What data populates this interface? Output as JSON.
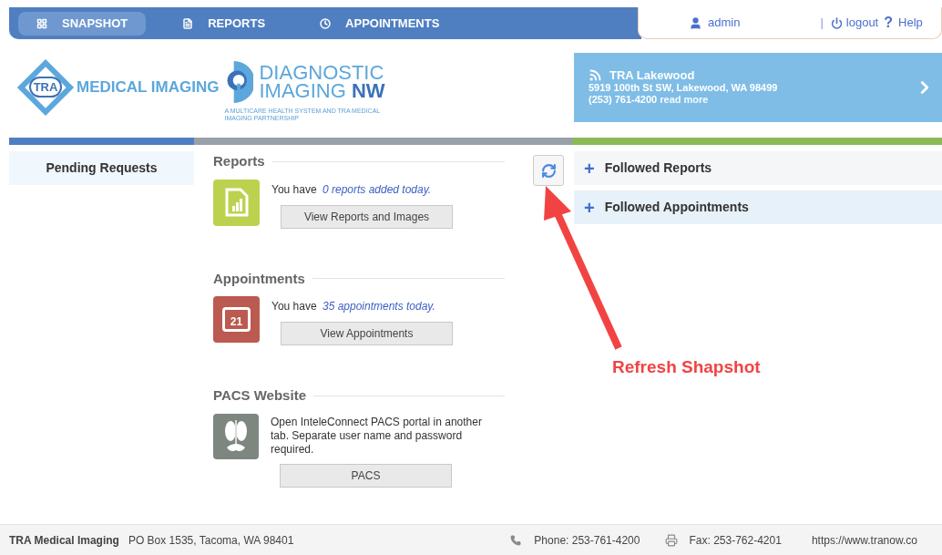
{
  "nav": {
    "tabs": [
      {
        "label": "SNAPSHOT",
        "selected": true
      },
      {
        "label": "REPORTS",
        "selected": false
      },
      {
        "label": "APPOINTMENTS",
        "selected": false
      }
    ],
    "user": "admin",
    "separator": "|",
    "logout": "logout",
    "help_icon": "?",
    "help": "Help"
  },
  "logos": {
    "tra_badge": "TRA",
    "tra_name": "MEDICAL IMAGING",
    "dinw_line1": "DIAGNOSTIC",
    "dinw_line2a": "IMAGING",
    "dinw_line2b": "NW",
    "dinw_tagline": "A MULTICARE HEALTH SYSTEM AND TRA MEDICAL IMAGING PARTNERSHIP"
  },
  "location": {
    "name": "TRA Lakewood",
    "address": "5919 100th St SW, Lakewood, WA 98499",
    "phone": "(253) 761-4200",
    "link": "read more"
  },
  "sidebar": {
    "title": "Pending Requests"
  },
  "sections": [
    {
      "kind": "reports",
      "title": "Reports",
      "lead": "You have",
      "emphasis": "0 reports added today.",
      "button": "View Reports and Images"
    },
    {
      "kind": "appointments",
      "title": "Appointments",
      "lead": "You have",
      "emphasis": "35 appointments today.",
      "icon_text": "21",
      "button": "View Appointments"
    },
    {
      "kind": "pacs",
      "title": "PACS Website",
      "text": "Open InteleConnect PACS portal in another tab. Separate user name and password required.",
      "button": "PACS"
    }
  ],
  "followed": [
    {
      "icon": "+",
      "label": "Followed Reports"
    },
    {
      "icon": "+",
      "label": "Followed Appointments"
    }
  ],
  "annotation": "Refresh Shapshot",
  "footer": {
    "company": "TRA Medical Imaging",
    "address": "PO Box 1535, Tacoma, WA 98401",
    "phone": "Phone: 253-761-4200",
    "fax": "Fax: 253-762-4201",
    "url": "https://www.tranow.co"
  }
}
